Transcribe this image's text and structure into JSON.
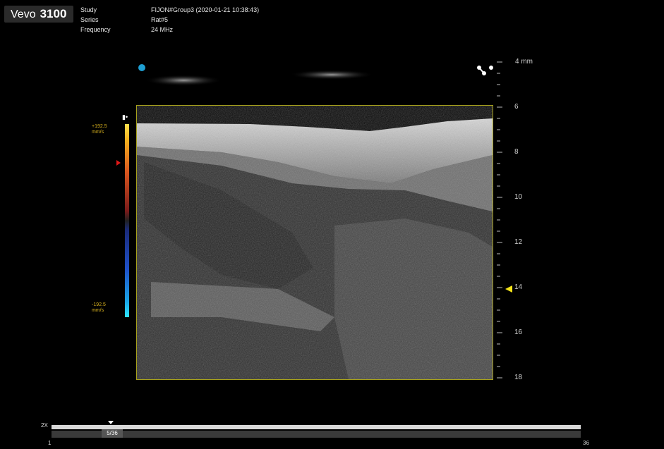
{
  "app": {
    "brand": "Vevo",
    "model": "3100"
  },
  "meta": {
    "labels": [
      "Study",
      "Series",
      "Frequency"
    ],
    "values": [
      "FIJON#Group3 (2020-01-21 10:38:43)",
      "Rat#5",
      "24 MHz"
    ]
  },
  "depth_scale": {
    "unit_label": "4 mm",
    "ticks": [
      "6",
      "8",
      "10",
      "12",
      "14",
      "16",
      "18"
    ]
  },
  "colorbar": {
    "top_value": "+192.5",
    "top_unit": "mm/s",
    "bottom_value": "-192.5",
    "bottom_unit": "mm/s"
  },
  "timeline": {
    "zoom": "2X",
    "current_frame": "5/36",
    "start": "1",
    "end": "36"
  },
  "colors": {
    "frame_border": "#a8a21c",
    "probe_dot": "#1e9fd3",
    "depth_marker": "#f5e41a",
    "colorbar_label": "#d9b21e"
  },
  "icons": [
    "probe-dot",
    "orientation-icon",
    "color-scale-icon"
  ]
}
